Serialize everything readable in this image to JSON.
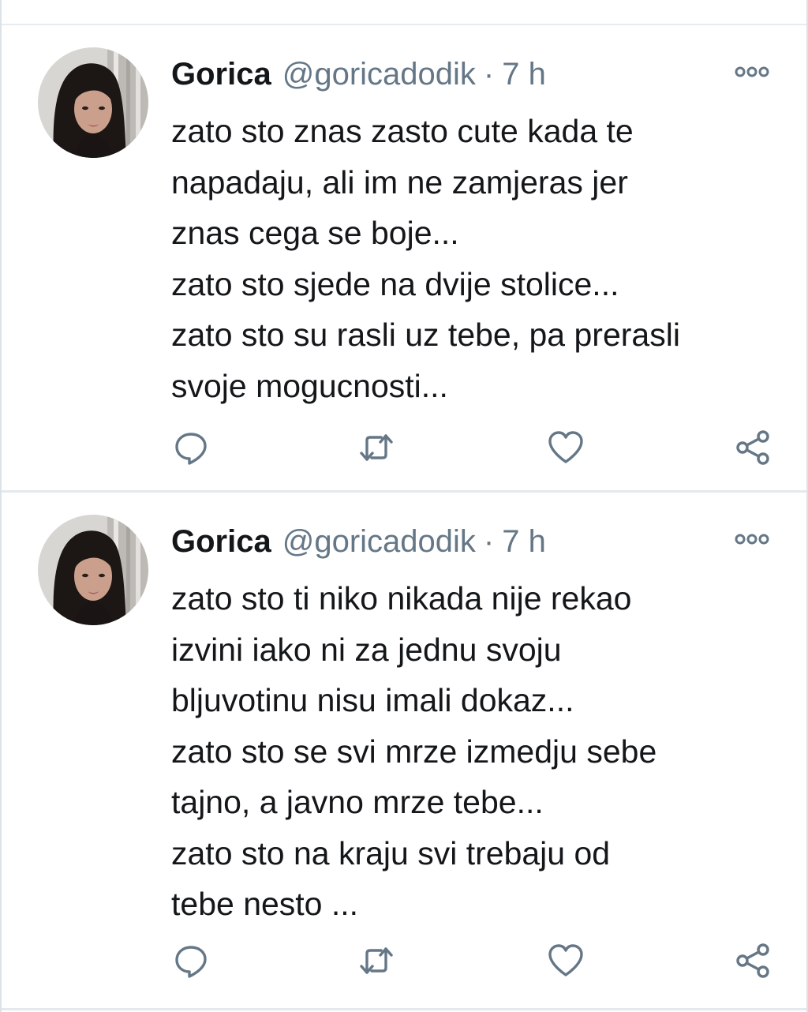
{
  "tweets": [
    {
      "display_name": "Gorica",
      "handle": "@goricadodik",
      "separator": "·",
      "time": "7 h",
      "avatar_icon": "profile-photo",
      "more_icon": "more-options-icon",
      "text_lines": [
        "zato sto znas zasto cute kada te",
        "napadaju, ali im ne zamjeras jer",
        "znas cega se boje...",
        "zato sto sjede na dvije stolice...",
        "zato sto su rasli uz tebe, pa prerasli",
        "svoje mogucnosti..."
      ],
      "actions": [
        "reply-icon",
        "retweet-icon",
        "like-icon",
        "share-icon"
      ]
    },
    {
      "display_name": "Gorica",
      "handle": "@goricadodik",
      "separator": "·",
      "time": "7 h",
      "avatar_icon": "profile-photo",
      "more_icon": "more-options-icon",
      "text_lines": [
        "zato sto ti niko nikada nije rekao",
        "izvini iako ni za jednu svoju",
        "bljuvotinu nisu imali dokaz...",
        "zato sto se svi mrze izmedju sebe",
        "tajno, a javno mrze tebe...",
        "zato sto na kraju svi trebaju od",
        "tebe nesto ..."
      ],
      "actions": [
        "reply-icon",
        "retweet-icon",
        "like-icon",
        "share-icon"
      ]
    }
  ],
  "colors": {
    "text": "#14171a",
    "secondary": "#657786",
    "icon": "#657786",
    "divider": "#e4e9ed"
  }
}
